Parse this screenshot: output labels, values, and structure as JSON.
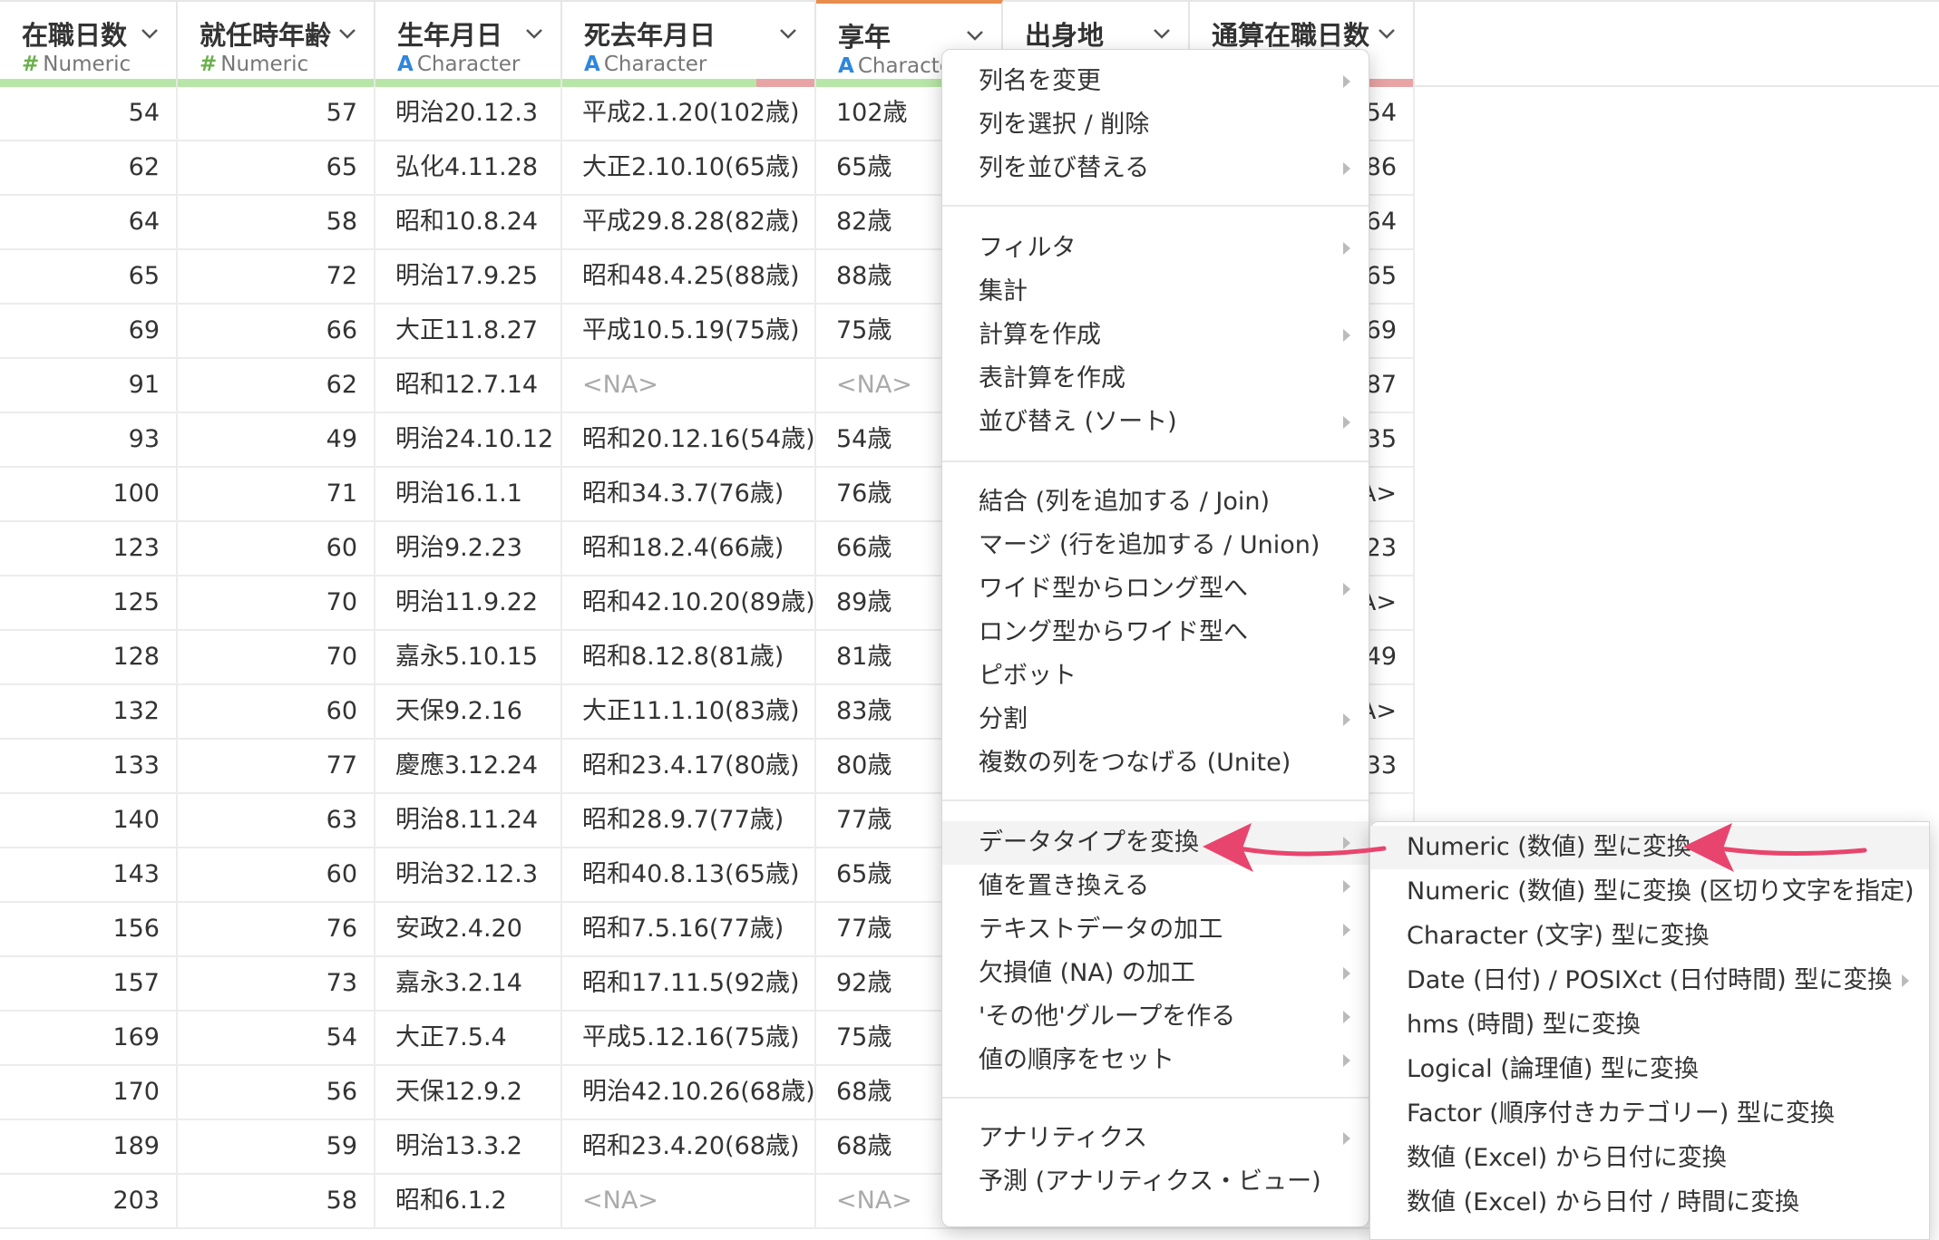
{
  "columns": [
    {
      "name": "在職日数",
      "type_icon": "#",
      "type_label": "Numeric",
      "kind": "num",
      "bar_color": "#b8e6a8"
    },
    {
      "name": "就任時年齢",
      "type_icon": "#",
      "type_label": "Numeric",
      "kind": "num",
      "bar_color": "#b8e6a8"
    },
    {
      "name": "生年月日",
      "type_icon": "A",
      "type_label": "Character",
      "kind": "chr",
      "bar_color": "#b8e6a8"
    },
    {
      "name": "死去年月日",
      "type_icon": "A",
      "type_label": "Character",
      "kind": "chr",
      "bar_color": "#b8e6a8"
    },
    {
      "name": "享年",
      "type_icon": "A",
      "type_label": "Characte",
      "kind": "chr",
      "bar_color": "#b8e6a8"
    },
    {
      "name": "出身地",
      "type_icon": "",
      "type_label": "",
      "kind": "chr",
      "bar_color": "#b8e6a8"
    },
    {
      "name": "通算在職日数",
      "type_icon": "",
      "type_label": "",
      "kind": "num",
      "bar_color": "#b8e6a8"
    }
  ],
  "rows": [
    [
      "54",
      "57",
      "明治20.12.3",
      "平成2.1.20(102歳)",
      "102歳",
      "",
      "54"
    ],
    [
      "62",
      "65",
      "弘化4.11.28",
      "大正2.10.10(65歳)",
      "65歳",
      "",
      "86"
    ],
    [
      "64",
      "58",
      "昭和10.8.24",
      "平成29.8.28(82歳)",
      "82歳",
      "",
      "64"
    ],
    [
      "65",
      "72",
      "明治17.9.25",
      "昭和48.4.25(88歳)",
      "88歳",
      "",
      "65"
    ],
    [
      "69",
      "66",
      "大正11.8.27",
      "平成10.5.19(75歳)",
      "75歳",
      "",
      "69"
    ],
    [
      "91",
      "62",
      "昭和12.7.14",
      "<NA>",
      "<NA>",
      "",
      "87"
    ],
    [
      "93",
      "49",
      "明治24.10.12",
      "昭和20.12.16(54歳)",
      "54歳",
      "",
      "35"
    ],
    [
      "100",
      "71",
      "明治16.1.1",
      "昭和34.3.7(76歳)",
      "76歳",
      "",
      "A>"
    ],
    [
      "123",
      "60",
      "明治9.2.23",
      "昭和18.2.4(66歳)",
      "66歳",
      "",
      "23"
    ],
    [
      "125",
      "70",
      "明治11.9.22",
      "昭和42.10.20(89歳)",
      "89歳",
      "",
      "A>"
    ],
    [
      "128",
      "70",
      "嘉永5.10.15",
      "昭和8.12.8(81歳)",
      "81歳",
      "",
      "49"
    ],
    [
      "132",
      "60",
      "天保9.2.16",
      "大正11.1.10(83歳)",
      "83歳",
      "",
      "A>"
    ],
    [
      "133",
      "77",
      "慶應3.12.24",
      "昭和23.4.17(80歳)",
      "80歳",
      "",
      "33"
    ],
    [
      "140",
      "63",
      "明治8.11.24",
      "昭和28.9.7(77歳)",
      "77歳",
      "",
      ""
    ],
    [
      "143",
      "60",
      "明治32.12.3",
      "昭和40.8.13(65歳)",
      "65歳",
      "",
      ""
    ],
    [
      "156",
      "76",
      "安政2.4.20",
      "昭和7.5.16(77歳)",
      "77歳",
      "",
      ""
    ],
    [
      "157",
      "73",
      "嘉永3.2.14",
      "昭和17.11.5(92歳)",
      "92歳",
      "",
      ""
    ],
    [
      "169",
      "54",
      "大正7.5.4",
      "平成5.12.16(75歳)",
      "75歳",
      "",
      ""
    ],
    [
      "170",
      "56",
      "天保12.9.2",
      "明治42.10.26(68歳)",
      "68歳",
      "",
      ""
    ],
    [
      "189",
      "59",
      "明治13.3.2",
      "昭和23.4.20(68歳)",
      "68歳",
      "",
      ""
    ],
    [
      "203",
      "58",
      "昭和6.1.2",
      "<NA>",
      "<NA>",
      "",
      ""
    ]
  ],
  "context_menu": {
    "groups": [
      [
        {
          "label": "列名を変更",
          "submenu": true
        },
        {
          "label": "列を選択 / 削除",
          "submenu": false
        },
        {
          "label": "列を並び替える",
          "submenu": true
        }
      ],
      [
        {
          "label": "フィルタ",
          "submenu": true
        },
        {
          "label": "集計",
          "submenu": false
        },
        {
          "label": "計算を作成",
          "submenu": true
        },
        {
          "label": "表計算を作成",
          "submenu": false
        },
        {
          "label": "並び替え (ソート)",
          "submenu": true
        }
      ],
      [
        {
          "label": "結合 (列を追加する / Join)",
          "submenu": false
        },
        {
          "label": "マージ (行を追加する / Union)",
          "submenu": false
        },
        {
          "label": "ワイド型からロング型へ",
          "submenu": true
        },
        {
          "label": "ロング型からワイド型へ",
          "submenu": false
        },
        {
          "label": "ピボット",
          "submenu": false
        },
        {
          "label": "分割",
          "submenu": true
        },
        {
          "label": "複数の列をつなげる (Unite)",
          "submenu": false
        }
      ],
      [
        {
          "label": "データタイプを変換",
          "submenu": true,
          "highlighted": true
        },
        {
          "label": "値を置き換える",
          "submenu": true
        },
        {
          "label": "テキストデータの加工",
          "submenu": true
        },
        {
          "label": "欠損値 (NA) の加工",
          "submenu": true
        },
        {
          "label": "'その他'グループを作る",
          "submenu": true
        },
        {
          "label": "値の順序をセット",
          "submenu": true
        }
      ],
      [
        {
          "label": "アナリティクス",
          "submenu": true
        },
        {
          "label": "予測 (アナリティクス・ビュー)",
          "submenu": false
        }
      ]
    ]
  },
  "submenu": {
    "items": [
      {
        "label": "Numeric (数値) 型に変換",
        "submenu": false,
        "highlighted": true
      },
      {
        "label": "Numeric (数値) 型に変換 (区切り文字を指定)",
        "submenu": false
      },
      {
        "label": "Character (文字) 型に変換",
        "submenu": false
      },
      {
        "label": "Date (日付) / POSIXct (日付時間) 型に変換",
        "submenu": true
      },
      {
        "label": "hms (時間) 型に変換",
        "submenu": false
      },
      {
        "label": "Logical (論理値) 型に変換",
        "submenu": false
      },
      {
        "label": "Factor (順序付きカテゴリー) 型に変換",
        "submenu": false
      },
      {
        "label": "数値 (Excel) から日付に変換",
        "submenu": false
      },
      {
        "label": "数値 (Excel) から日付 / 時間に変換",
        "submenu": false
      }
    ]
  },
  "colors": {
    "accent_arrow": "#e8456e",
    "active_column": "#e88e4c",
    "numeric_icon": "#6ab04c",
    "character_icon": "#2e86de",
    "na_text": "#aaaaaa"
  }
}
